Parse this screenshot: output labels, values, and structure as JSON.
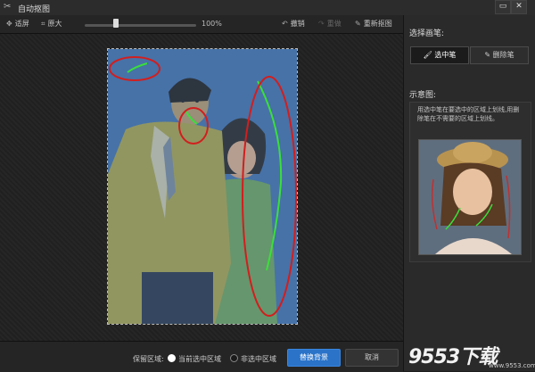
{
  "window": {
    "title": "自动抠图",
    "icon": "scissors-icon"
  },
  "toolbar": {
    "fit_label": "适屏",
    "original_label": "原大",
    "zoom_value": "100%",
    "zoom_fraction": 0.28,
    "undo_label": "撤销",
    "redo_label": "重做",
    "reset_label": "重新抠图"
  },
  "panel": {
    "brush_title": "选择画笔:",
    "select_brush_label": "选中笔",
    "erase_brush_label": "删除笔",
    "example_title": "示意图:",
    "example_text": "用选中笔在要选中的区域上划线,用删除笔在不需要的区域上划线。"
  },
  "bottom": {
    "keep_label": "保留区域:",
    "option_current": "当前选中区域",
    "option_unselected": "非选中区域",
    "replace_bg_label": "替换背景",
    "cancel_label": "取消"
  },
  "watermark": {
    "text": "9553下载",
    "url": "www.9553.com"
  },
  "colors": {
    "accent": "#2a73c9",
    "overlay": "#4a73a6",
    "select_stroke": "#3adf3a",
    "erase_stroke": "#d21e1e"
  }
}
